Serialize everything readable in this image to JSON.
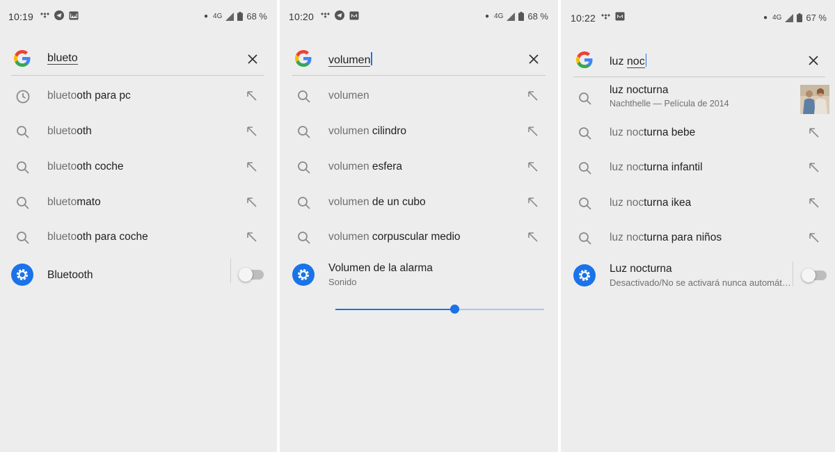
{
  "panels": [
    {
      "status": {
        "time": "10:19",
        "network": "4G",
        "battery": "68 %"
      },
      "search": {
        "typed": "blueto",
        "after": ""
      },
      "suggestions": [
        {
          "icon": "history-icon",
          "prefix": "blueto",
          "suffix": "oth para pc"
        },
        {
          "icon": "search-icon",
          "prefix": "blueto",
          "suffix": "oth"
        },
        {
          "icon": "search-icon",
          "prefix": "blueto",
          "suffix": "oth coche"
        },
        {
          "icon": "search-icon",
          "prefix": "blueto",
          "suffix": "mato"
        },
        {
          "icon": "search-icon",
          "prefix": "blueto",
          "suffix": "oth para coche"
        }
      ],
      "setting": {
        "title": "Bluetooth",
        "toggle_on": false
      }
    },
    {
      "status": {
        "time": "10:20",
        "network": "4G",
        "battery": "68 %"
      },
      "search": {
        "typed": "volumen",
        "after": ""
      },
      "suggestions": [
        {
          "icon": "search-icon",
          "prefix": "volumen",
          "suffix": ""
        },
        {
          "icon": "search-icon",
          "prefix": "volumen",
          "suffix": " cilindro"
        },
        {
          "icon": "search-icon",
          "prefix": "volumen",
          "suffix": " esfera"
        },
        {
          "icon": "search-icon",
          "prefix": "volumen",
          "suffix": " de un cubo"
        },
        {
          "icon": "search-icon",
          "prefix": "volumen",
          "suffix": " corpuscular medio"
        }
      ],
      "setting": {
        "title": "Volumen de la alarma",
        "subtitle": "Sonido",
        "slider_level": 0.57
      }
    },
    {
      "status": {
        "time": "10:22",
        "network": "4G",
        "battery": "67 %"
      },
      "search": {
        "before": "luz ",
        "typed": "noc"
      },
      "rich_result": {
        "title": "luz nocturna",
        "subtitle": "Nachthelle — Película de 2014"
      },
      "suggestions": [
        {
          "icon": "search-icon",
          "prefix": "luz noc",
          "suffix": "turna bebe"
        },
        {
          "icon": "search-icon",
          "prefix": "luz noc",
          "suffix": "turna infantil"
        },
        {
          "icon": "search-icon",
          "prefix": "luz noc",
          "suffix": "turna ikea"
        },
        {
          "icon": "search-icon",
          "prefix": "luz noc",
          "suffix": "turna para niños"
        }
      ],
      "setting": {
        "title": "Luz nocturna",
        "subtitle": "Desactivado/No se activará nunca automáticamente",
        "toggle_on": false
      }
    }
  ],
  "colors": {
    "background": "#ededed",
    "accent": "#1a73e8",
    "muted_text": "#6f6f6f",
    "text": "#202124"
  }
}
